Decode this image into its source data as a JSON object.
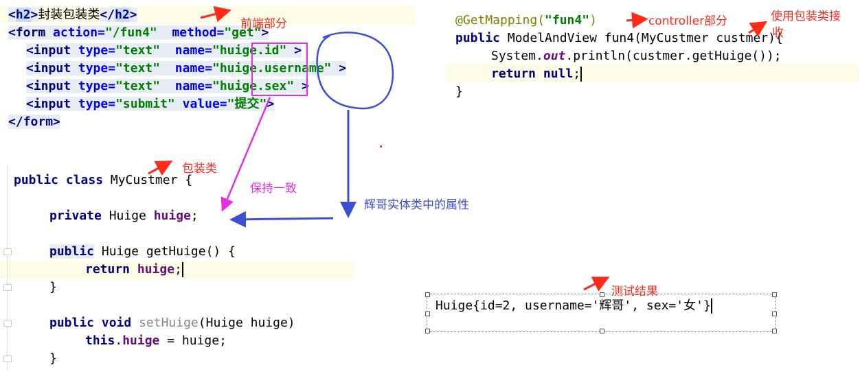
{
  "html_code": {
    "lines": [
      {
        "open": "<",
        "tag": "h2",
        "close": ">",
        "text": "封装包装类",
        "end_open": "</",
        "end_tag": "h2",
        "end_close": ">"
      },
      {
        "p1": "<",
        "tag": "form",
        "a1": " action",
        "e1": "=",
        "v1": "\"/fun4\"",
        "a2": "  method",
        "e2": "=",
        "v2": "\"get\"",
        "p2": ">"
      },
      {
        "p1": "<",
        "tag": "input",
        "a1": " type",
        "e1": "=",
        "v1": "\"text\"",
        "a2": "  name",
        "e2": "=",
        "v2a": "\"",
        "box": "huige",
        "v2b": ".id\"",
        "p2": " >"
      },
      {
        "p1": "<",
        "tag": "input",
        "a1": " type",
        "e1": "=",
        "v1": "\"text\"",
        "a2": "  name",
        "e2": "=",
        "v2a": "\"",
        "box": "huige",
        "v2b": ".username\"",
        "p2": " >"
      },
      {
        "p1": "<",
        "tag": "input",
        "a1": " type",
        "e1": "=",
        "v1": "\"text\"",
        "a2": "  name",
        "e2": "=",
        "v2a": "\"",
        "box": "huige",
        "v2b": ".sex\"",
        "p2": " >"
      },
      {
        "p1": "<",
        "tag": "input",
        "a1": " type",
        "e1": "=",
        "v1": "\"submit\"",
        "a2": " value",
        "e2": "=",
        "v2": "\"提交\"",
        "p2": ">"
      },
      {
        "p1": "</",
        "tag": "form",
        "p2": ">"
      }
    ]
  },
  "controller_code": {
    "l1_anno": "@GetMapping(",
    "l1_str": "\"fun4\"",
    "l1_end": ")",
    "l2_kw": "public",
    "l2_rest": " ModelAndView fun4(MyCustmer custmer){",
    "l3_a": "System.",
    "l3_out": "out",
    "l3_b": ".println(custmer.getHuige());",
    "l4_kw1": "return",
    "l4_sp": " ",
    "l4_kw2": "null",
    "l4_end": ";",
    "l5": "}"
  },
  "class_code": {
    "l1_kw": "public class",
    "l1_name": " MyCustmer",
    "l1_end": " {",
    "l2_kw": "private",
    "l2_type": " Huige ",
    "l2_fld": "huige",
    "l2_end": ";",
    "l3_kw": "public",
    "l3_rest": " Huige getHuige() {",
    "l4_kw": "return",
    "l4_sp": " ",
    "l4_fld": "huige",
    "l4_end": ";",
    "l5": "}",
    "l6_kw": "public void",
    "l6_sp": " ",
    "l6_name": "setHuige",
    "l6_rest": "(Huige huige)",
    "l7_kw": "this",
    "l7_dot": ".",
    "l7_fld": "huige",
    "l7_rest": " = huige;",
    "l8": "}"
  },
  "result": {
    "text": "Huige{id=2, username='辉哥', sex='女'}"
  },
  "annotations": {
    "frontend": "前端部分",
    "controller": "controller部分",
    "wrapper_line1": "使用包装类接",
    "wrapper_line2": "收",
    "wrapper_class": "包装类",
    "keep_same": "保持一致",
    "entity_attr": "辉哥实体类中的属性",
    "test_result": "测试结果"
  },
  "colors": {
    "annotation_red": "#ff2a1a",
    "annotation_magenta": "#e62ee6",
    "annotation_blue": "#3b4fd0",
    "line_highlight": "#fefbe6"
  }
}
